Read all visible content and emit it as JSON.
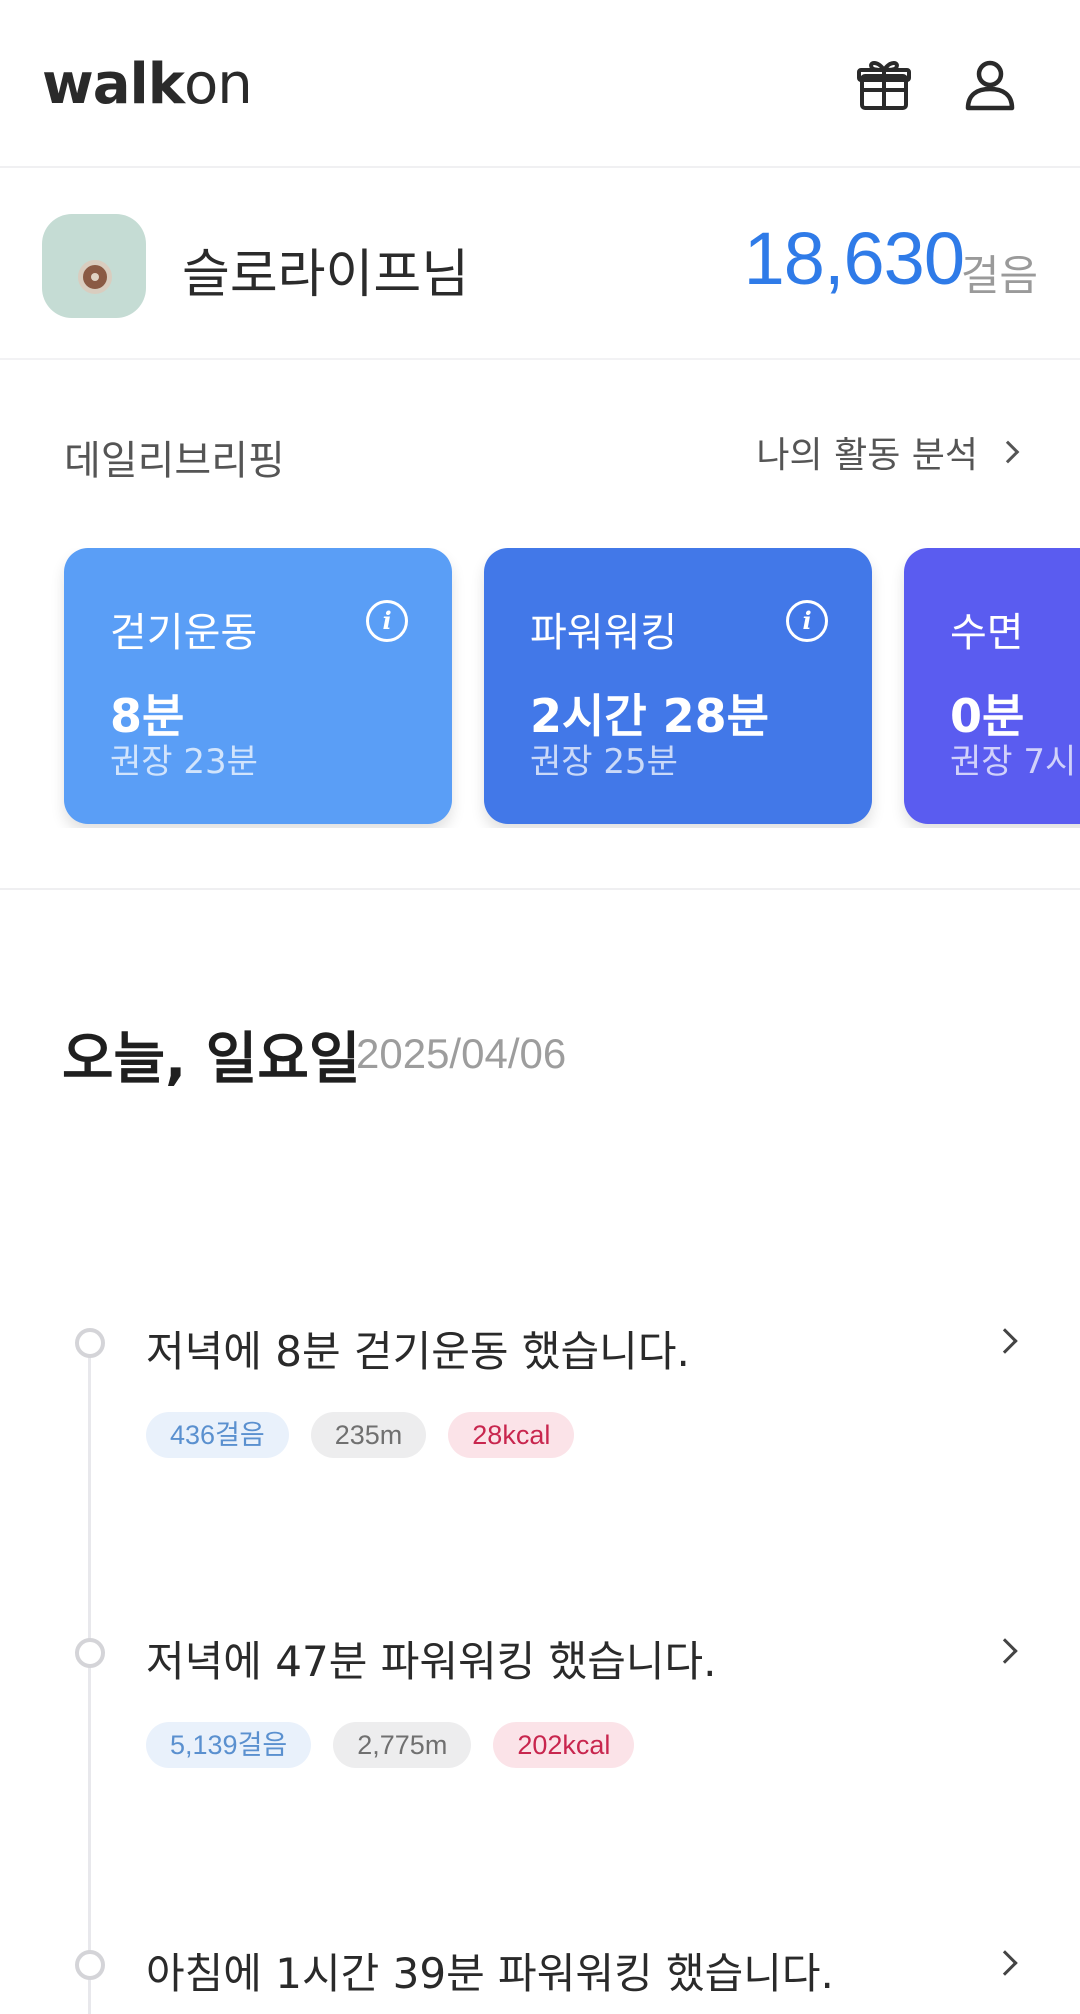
{
  "app": {
    "logo_bold": "walk",
    "logo_light": "on"
  },
  "header": {
    "icons": [
      "gift-icon",
      "user-icon"
    ]
  },
  "profile": {
    "name": "슬로라이프님",
    "steps": "18,630",
    "steps_unit": "걸음"
  },
  "briefing": {
    "title": "데일리브리핑",
    "link_label": "나의 활동 분석",
    "cards": [
      {
        "title": "걷기운동",
        "value": "8분",
        "recommend": "권장 23분",
        "color": "#5a9ef6"
      },
      {
        "title": "파워워킹",
        "value": "2시간 28분",
        "recommend": "권장 25분",
        "color": "#4278e8"
      },
      {
        "title": "수면",
        "value": "0분",
        "recommend": "권장 7시",
        "color": "#5a5cf0"
      }
    ]
  },
  "today": {
    "title": "오늘, 일요일",
    "date": "2025/04/06"
  },
  "timeline": [
    {
      "text": "저녁에 8분 걷기운동 했습니다.",
      "steps": "436걸음",
      "distance": "235m",
      "kcal": "28kcal"
    },
    {
      "text": "저녁에 47분 파워워킹 했습니다.",
      "steps": "5,139걸음",
      "distance": "2,775m",
      "kcal": "202kcal"
    },
    {
      "text": "아침에 1시간 39분 파워워킹 했습니다."
    }
  ]
}
